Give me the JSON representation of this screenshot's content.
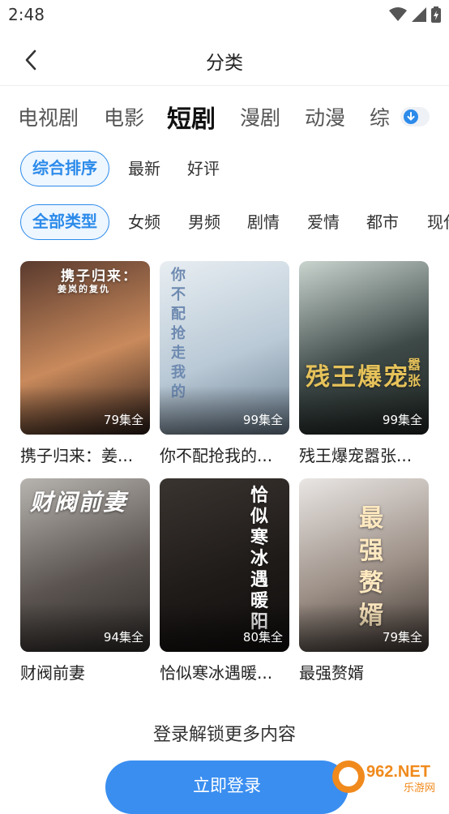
{
  "status_bar": {
    "time": "2:48"
  },
  "nav": {
    "title": "分类"
  },
  "category_tabs": [
    {
      "label": "电视剧",
      "active": false
    },
    {
      "label": "电影",
      "active": false
    },
    {
      "label": "短剧",
      "active": true
    },
    {
      "label": "漫剧",
      "active": false
    },
    {
      "label": "动漫",
      "active": false
    },
    {
      "label": "综",
      "active": false
    }
  ],
  "sort_filters": [
    {
      "label": "综合排序",
      "active": true
    },
    {
      "label": "最新",
      "active": false
    },
    {
      "label": "好评",
      "active": false
    }
  ],
  "type_filters": [
    {
      "label": "全部类型",
      "active": true
    },
    {
      "label": "女频",
      "active": false
    },
    {
      "label": "男频",
      "active": false
    },
    {
      "label": "剧情",
      "active": false
    },
    {
      "label": "爱情",
      "active": false
    },
    {
      "label": "都市",
      "active": false
    },
    {
      "label": "现代",
      "active": false
    }
  ],
  "dramas": [
    {
      "title": "携子归来：姜...",
      "episodes": "79集全",
      "poster_text": "携子归来：",
      "poster_subtext": "姜岚的复仇",
      "colors": [
        "#5a3a2e",
        "#c98a5c",
        "#2a1c18"
      ]
    },
    {
      "title": "你不配抢我的...",
      "episodes": "99集全",
      "poster_text": "你不配抢走我的",
      "poster_subtext": "",
      "colors": [
        "#e8eef2",
        "#b9c9d6",
        "#6b7d8e"
      ]
    },
    {
      "title": "残王爆宠嚣张...",
      "episodes": "99集全",
      "poster_text": "残王爆宠",
      "poster_subtext": "嚣张",
      "colors": [
        "#c9d4cf",
        "#3e4a48",
        "#1e2422"
      ]
    },
    {
      "title": "财阀前妻",
      "episodes": "94集全",
      "poster_text": "财阀前妻",
      "poster_subtext": "",
      "colors": [
        "#b7b4b0",
        "#5b5450",
        "#2d2a28"
      ]
    },
    {
      "title": "恰似寒冰遇暖...",
      "episodes": "80集全",
      "poster_text": "恰似寒冰遇暖阳",
      "poster_subtext": "",
      "colors": [
        "#3a3430",
        "#1f1b19",
        "#0f0d0c"
      ]
    },
    {
      "title": "最强赘婿",
      "episodes": "79集全",
      "poster_text": "最强赘婿",
      "poster_subtext": "",
      "colors": [
        "#e9e6e4",
        "#9c8f86",
        "#3b332e"
      ]
    }
  ],
  "login_prompt": "登录解锁更多内容",
  "login_button": "立即登录",
  "watermark": {
    "text": "962.NET",
    "subtext": "乐游网"
  }
}
